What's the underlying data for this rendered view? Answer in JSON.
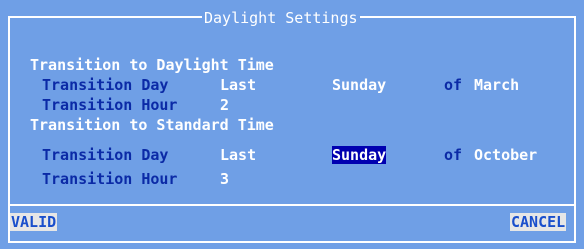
{
  "dialog": {
    "title": "Daylight Settings"
  },
  "daylight": {
    "heading": "Transition to Daylight Time",
    "day_label": "Transition Day",
    "day_occurrence": "Last",
    "day_weekday": "Sunday",
    "of_label": "of",
    "month": "March",
    "hour_label": "Transition Hour",
    "hour_value": "2"
  },
  "standard": {
    "heading": "Transition to Standard Time",
    "day_label": "Transition Day",
    "day_occurrence": "Last",
    "day_weekday": "Sunday",
    "of_label": "of",
    "month": "October",
    "hour_label": "Transition Hour",
    "hour_value": "3"
  },
  "buttons": {
    "valid": "VALID",
    "cancel": "CANCEL"
  },
  "colors": {
    "background": "#6f9fe6",
    "label_blue": "#0b2aa6",
    "value_white": "#ffffff",
    "highlight": "#0000b0",
    "button_bg": "#e6e6e6"
  }
}
